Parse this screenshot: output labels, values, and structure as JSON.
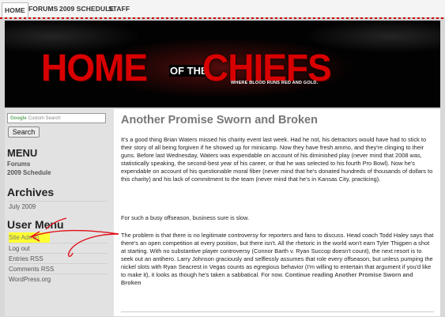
{
  "nav": {
    "tabs": [
      {
        "label": "HOME",
        "active": true
      },
      {
        "label": "FORUMS",
        "active": false
      },
      {
        "label": "2009 SCHEDULE",
        "active": false
      },
      {
        "label": "STAFF",
        "active": false
      }
    ]
  },
  "banner": {
    "title_part1": "HOME",
    "title_of": "OF THE",
    "title_part2": "CHIEFS",
    "tagline": "WHERE BLOOD RUNS RED AND GOLD."
  },
  "sidebar": {
    "search": {
      "logo_text": "Google",
      "placeholder": "Custom Search",
      "button": "Search"
    },
    "menu": {
      "heading": "MENU",
      "links": [
        "Forums",
        "2009 Schedule"
      ]
    },
    "archives": {
      "heading": "Archives",
      "items": [
        "July 2009"
      ]
    },
    "user_menu": {
      "heading": "User Menu",
      "items": [
        "Site Admin",
        "Log out",
        "Entries RSS",
        "Comments RSS",
        "WordPress.org"
      ]
    }
  },
  "post": {
    "title": "Another Promise Sworn and Broken",
    "paragraphs": [
      "It's a good thing Brian Waters missed his charity event last week. Had he not, his detractors would have had to stick to their story of all being forgiven if he showed up for minicamp. Now they have fresh ammo, and they're clinging to their guns. Before last Wednesday, Waters was expendable on account of his diminished play (never mind that 2008 was, statistically speaking, the second-best year of his career, or that he was selected to his fourth Pro Bowl). Now he's expendable on account of his questionable moral fiber (never mind that he's donated hundreds of thousands of dollars to this charity) and his lack of commitment to the team (never mind that he's in Kansas City, practicing).",
      "For such a busy offseason, business sure is slow.",
      "The problem is that there is no legitimate controversy for reporters and fans to discuss. Head coach Todd Haley says that there's an open competition at every position, but there isn't. All the rhetoric in the world won't earn Tyler Thigpen a shot at starting. With no substantive player controversy (Connor Barth v. Ryan Succop doesn't count), the next resort is to seek out an antihero. Larry Johnson graciously and selflessly assumes that role every offseason, but unless pumping the nickel slots with Ryan Seacrest in Vegas counts as egregious behavior (I'm willing to entertain that argument if you'd like to make it), it looks as though he's taken a sabbatical. For now."
    ],
    "continue_link": "Continue reading Another Promise Sworn and Broken"
  },
  "colors": {
    "annotation_red": "#e0101a",
    "highlight": "#ffff33",
    "banner_red": "#d80000"
  }
}
